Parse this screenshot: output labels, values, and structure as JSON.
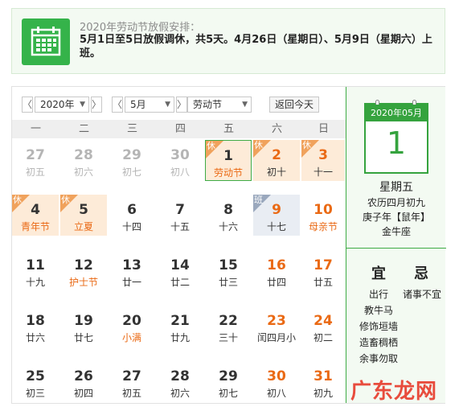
{
  "notice": {
    "title": "2020年劳动节放假安排：",
    "text": "5月1日至5日放假调休，共5天。4月26日（星期日）、5月9日（星期六）上班。",
    "icon": "calendar-icon"
  },
  "toolbar": {
    "prev": "〈",
    "next": "〉",
    "year": "2020年",
    "month": "5月",
    "holiday": "劳动节",
    "today_button": "返回今天"
  },
  "weekdays": [
    "一",
    "二",
    "三",
    "四",
    "五",
    "六",
    "日"
  ],
  "days": [
    {
      "num": "27",
      "lunar": "初五"
    },
    {
      "num": "28",
      "lunar": "初六"
    },
    {
      "num": "29",
      "lunar": "初七"
    },
    {
      "num": "30",
      "lunar": "初八"
    },
    {
      "num": "1",
      "lunar": "劳动节",
      "tag": "休"
    },
    {
      "num": "2",
      "lunar": "初十",
      "tag": "休"
    },
    {
      "num": "3",
      "lunar": "十一",
      "tag": "休"
    },
    {
      "num": "4",
      "lunar": "青年节",
      "tag": "休"
    },
    {
      "num": "5",
      "lunar": "立夏",
      "tag": "休"
    },
    {
      "num": "6",
      "lunar": "十四"
    },
    {
      "num": "7",
      "lunar": "十五"
    },
    {
      "num": "8",
      "lunar": "十六"
    },
    {
      "num": "9",
      "lunar": "十七",
      "tag": "班"
    },
    {
      "num": "10",
      "lunar": "母亲节"
    },
    {
      "num": "11",
      "lunar": "十九"
    },
    {
      "num": "12",
      "lunar": "护士节"
    },
    {
      "num": "13",
      "lunar": "廿一"
    },
    {
      "num": "14",
      "lunar": "廿二"
    },
    {
      "num": "15",
      "lunar": "廿三"
    },
    {
      "num": "16",
      "lunar": "廿四"
    },
    {
      "num": "17",
      "lunar": "廿五"
    },
    {
      "num": "18",
      "lunar": "廿六"
    },
    {
      "num": "19",
      "lunar": "廿七"
    },
    {
      "num": "20",
      "lunar": "小满"
    },
    {
      "num": "21",
      "lunar": "廿九"
    },
    {
      "num": "22",
      "lunar": "三十"
    },
    {
      "num": "23",
      "lunar": "闰四月小"
    },
    {
      "num": "24",
      "lunar": "初二"
    },
    {
      "num": "25",
      "lunar": "初三"
    },
    {
      "num": "26",
      "lunar": "初四"
    },
    {
      "num": "27",
      "lunar": "初五"
    },
    {
      "num": "28",
      "lunar": "初六"
    },
    {
      "num": "29",
      "lunar": "初七"
    },
    {
      "num": "30",
      "lunar": "初八"
    },
    {
      "num": "31",
      "lunar": "初九"
    }
  ],
  "side": {
    "header": "2020年05月",
    "day": "1",
    "weekday": "星期五",
    "lunar": "农历四月初九",
    "ganzhi": "庚子年【鼠年】",
    "constellation": "金牛座",
    "yi_label": "宜",
    "ji_label": "忌",
    "yi": [
      "出行",
      "教牛马",
      "修饰垣墙",
      "造畜稠栖",
      "余事勿取"
    ],
    "ji": [
      "诸事不宜"
    ]
  },
  "watermark": "广东龙网",
  "colors": {
    "accent_green": "#35a33e",
    "holiday_orange": "#ea6a15",
    "rest_bg": "#fdebd8",
    "work_bg": "#e9edf3"
  }
}
